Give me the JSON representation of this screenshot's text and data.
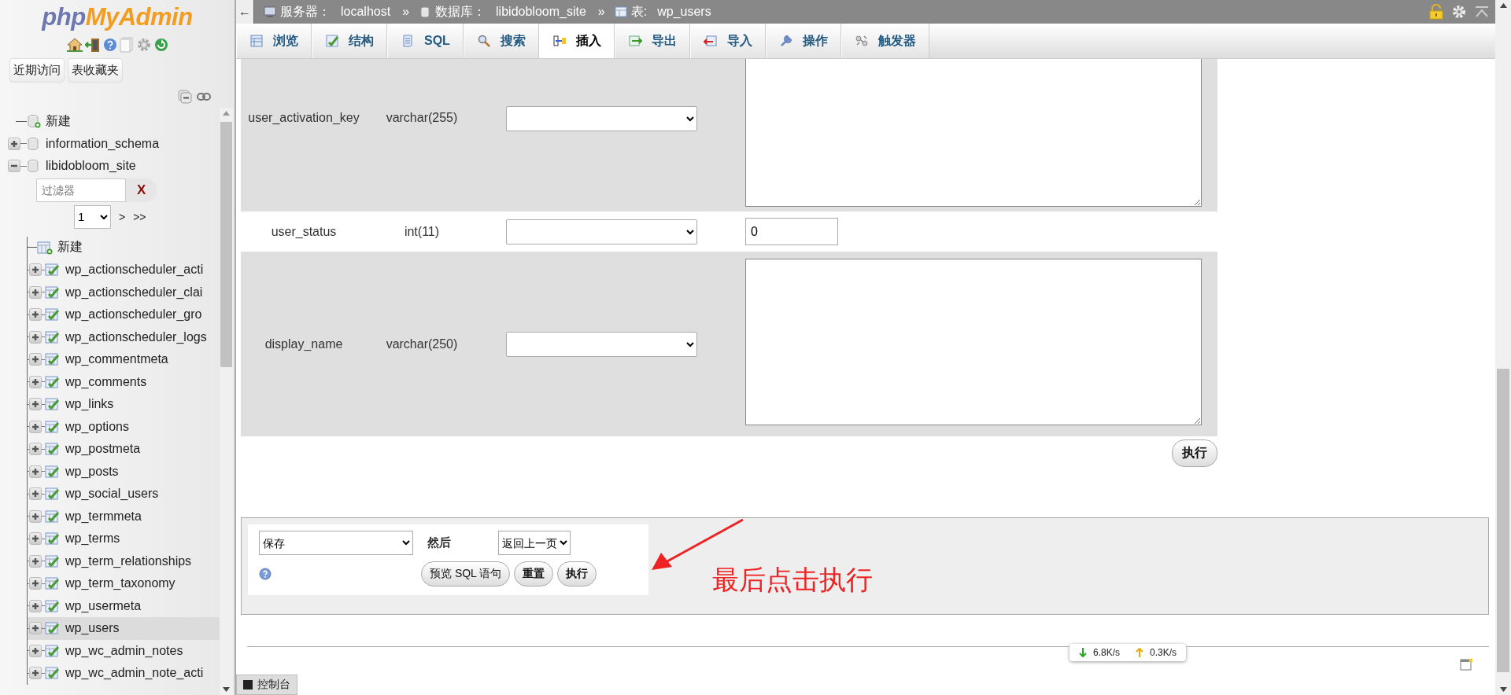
{
  "sidebar": {
    "logo": [
      "php",
      "MyAdmin"
    ],
    "buttons": [
      "近期访问",
      "表收藏夹"
    ],
    "tree": [
      {
        "kind": "new",
        "label": "新建"
      },
      {
        "kind": "database",
        "label": "information_schema",
        "expanded": false
      },
      {
        "kind": "database",
        "label": "libidobloom_site",
        "expanded": true,
        "filter": {
          "placeholder": "过滤器",
          "clear": "X"
        },
        "pager": {
          "page": "1",
          "next": ">",
          "last": ">>"
        },
        "children": [
          {
            "kind": "new",
            "label": "新建"
          },
          {
            "kind": "table",
            "label": "wp_actionscheduler_acti",
            "expanded": false,
            "selected": false
          },
          {
            "kind": "table",
            "label": "wp_actionscheduler_clai",
            "expanded": false,
            "selected": false
          },
          {
            "kind": "table",
            "label": "wp_actionscheduler_gro",
            "expanded": false,
            "selected": false
          },
          {
            "kind": "table",
            "label": "wp_actionscheduler_logs",
            "expanded": false,
            "selected": false
          },
          {
            "kind": "table",
            "label": "wp_commentmeta",
            "expanded": false,
            "selected": false
          },
          {
            "kind": "table",
            "label": "wp_comments",
            "expanded": false,
            "selected": false
          },
          {
            "kind": "table",
            "label": "wp_links",
            "expanded": false,
            "selected": false
          },
          {
            "kind": "table",
            "label": "wp_options",
            "expanded": false,
            "selected": false
          },
          {
            "kind": "table",
            "label": "wp_postmeta",
            "expanded": false,
            "selected": false
          },
          {
            "kind": "table",
            "label": "wp_posts",
            "expanded": false,
            "selected": false
          },
          {
            "kind": "table",
            "label": "wp_social_users",
            "expanded": false,
            "selected": false
          },
          {
            "kind": "table",
            "label": "wp_termmeta",
            "expanded": false,
            "selected": false
          },
          {
            "kind": "table",
            "label": "wp_terms",
            "expanded": false,
            "selected": false
          },
          {
            "kind": "table",
            "label": "wp_term_relationships",
            "expanded": false,
            "selected": false
          },
          {
            "kind": "table",
            "label": "wp_term_taxonomy",
            "expanded": false,
            "selected": false
          },
          {
            "kind": "table",
            "label": "wp_usermeta",
            "expanded": false,
            "selected": false
          },
          {
            "kind": "table",
            "label": "wp_users",
            "expanded": false,
            "selected": true
          },
          {
            "kind": "table",
            "label": "wp_wc_admin_notes",
            "expanded": false,
            "selected": false
          },
          {
            "kind": "table",
            "label": "wp_wc_admin_note_acti",
            "expanded": false,
            "selected": false
          }
        ]
      }
    ]
  },
  "breadcrumb": {
    "back": "←",
    "items": [
      {
        "kind": "server",
        "label": "服务器：",
        "value": "localhost",
        "separator": "»"
      },
      {
        "kind": "database",
        "label": "数据库：",
        "value": "libidobloom_site",
        "separator": "»"
      },
      {
        "kind": "table",
        "label": "表:",
        "value": "wp_users"
      }
    ]
  },
  "tabs": [
    {
      "kind": "browse",
      "label": "浏览",
      "selected": false
    },
    {
      "kind": "structure",
      "label": "结构",
      "selected": false
    },
    {
      "kind": "sql",
      "label": "SQL",
      "selected": false
    },
    {
      "kind": "search",
      "label": "搜索",
      "selected": false
    },
    {
      "kind": "insert",
      "label": "插入",
      "selected": true
    },
    {
      "kind": "export",
      "label": "导出",
      "selected": false
    },
    {
      "kind": "import",
      "label": "导入",
      "selected": false
    },
    {
      "kind": "operations",
      "label": "操作",
      "selected": false
    },
    {
      "kind": "triggers",
      "label": "触发器",
      "selected": false
    }
  ],
  "form": {
    "rows": [
      {
        "name": "user_activation_key",
        "type": "varchar(255)",
        "kind": "textarea"
      },
      {
        "name": "user_status",
        "type": "int(11)",
        "kind": "text",
        "value": "0"
      },
      {
        "name": "display_name",
        "type": "varchar(250)",
        "kind": "textarea"
      }
    ],
    "go_button": "执行"
  },
  "actions": {
    "save_select": "保存",
    "then_label": "然后",
    "after_select": "返回上一页",
    "buttons": [
      "预览 SQL 语句",
      "重置",
      "执行"
    ]
  },
  "annotation": "最后点击执行",
  "net": {
    "down": "6.8K/s",
    "up": "0.3K/s"
  },
  "console": "控制台"
}
